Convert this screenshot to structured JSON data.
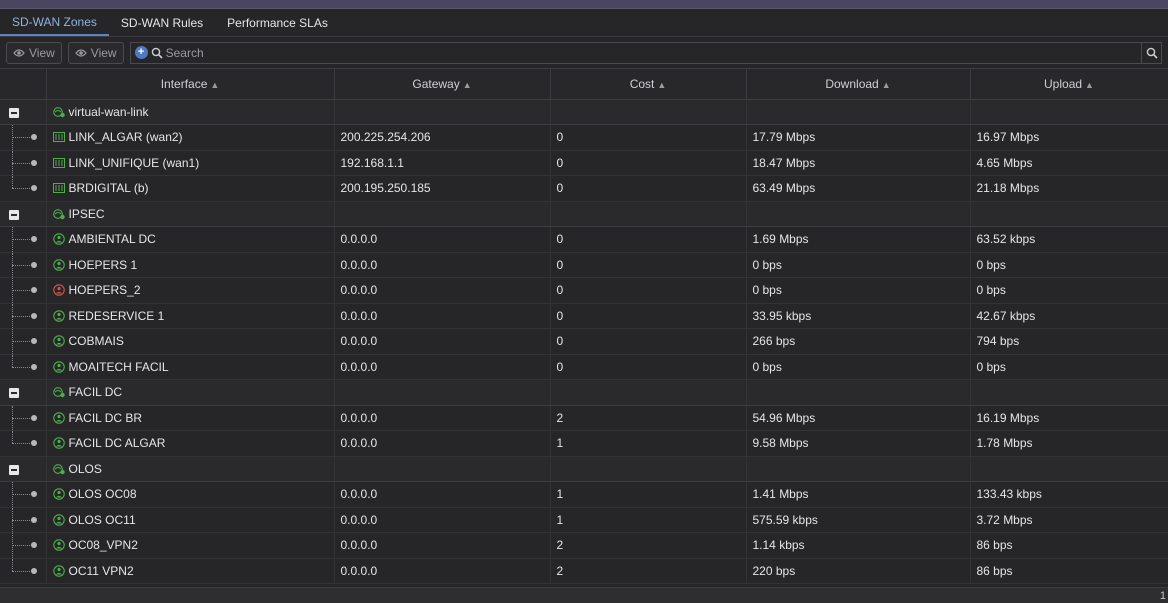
{
  "tabs": [
    "SD-WAN Zones",
    "SD-WAN Rules",
    "Performance SLAs"
  ],
  "toolbar": {
    "view1": "View",
    "view2": "View",
    "search_placeholder": "Search"
  },
  "columns": [
    "Interface",
    "Gateway",
    "Cost",
    "Download",
    "Upload"
  ],
  "groups": [
    {
      "name": "virtual-wan-link",
      "icon": "sdwan-zone-icon",
      "rows": [
        {
          "name": "LINK_ALGAR (wan2)",
          "icon": "port-icon",
          "gateway": "200.225.254.206",
          "cost": "0",
          "download": "17.79 Mbps",
          "upload": "16.97 Mbps"
        },
        {
          "name": "LINK_UNIFIQUE (wan1)",
          "icon": "port-icon",
          "gateway": "192.168.1.1",
          "cost": "0",
          "download": "18.47 Mbps",
          "upload": "4.65 Mbps"
        },
        {
          "name": "BRDIGITAL (b)",
          "icon": "port-icon",
          "gateway": "200.195.250.185",
          "cost": "0",
          "download": "63.49 Mbps",
          "upload": "21.18 Mbps"
        }
      ]
    },
    {
      "name": "IPSEC",
      "icon": "sdwan-zone-icon",
      "rows": [
        {
          "name": "AMBIENTAL DC",
          "icon": "tunnel-up-icon",
          "gateway": "0.0.0.0",
          "cost": "0",
          "download": "1.69 Mbps",
          "upload": "63.52 kbps"
        },
        {
          "name": "HOEPERS 1",
          "icon": "tunnel-up-icon",
          "gateway": "0.0.0.0",
          "cost": "0",
          "download": "0 bps",
          "upload": "0 bps"
        },
        {
          "name": "HOEPERS_2",
          "icon": "tunnel-down-icon",
          "gateway": "0.0.0.0",
          "cost": "0",
          "download": "0 bps",
          "upload": "0 bps"
        },
        {
          "name": "REDESERVICE 1",
          "icon": "tunnel-up-icon",
          "gateway": "0.0.0.0",
          "cost": "0",
          "download": "33.95 kbps",
          "upload": "42.67 kbps"
        },
        {
          "name": "COBMAIS",
          "icon": "tunnel-up-icon",
          "gateway": "0.0.0.0",
          "cost": "0",
          "download": "266 bps",
          "upload": "794 bps"
        },
        {
          "name": "MOAITECH FACIL",
          "icon": "tunnel-up-icon",
          "gateway": "0.0.0.0",
          "cost": "0",
          "download": "0 bps",
          "upload": "0 bps"
        }
      ]
    },
    {
      "name": "FACIL DC",
      "icon": "sdwan-zone-icon",
      "rows": [
        {
          "name": "FACIL DC BR",
          "icon": "tunnel-up-icon",
          "gateway": "0.0.0.0",
          "cost": "2",
          "download": "54.96 Mbps",
          "upload": "16.19 Mbps"
        },
        {
          "name": "FACIL DC ALGAR",
          "icon": "tunnel-up-icon",
          "gateway": "0.0.0.0",
          "cost": "1",
          "download": "9.58 Mbps",
          "upload": "1.78 Mbps"
        }
      ]
    },
    {
      "name": "OLOS",
      "icon": "sdwan-zone-icon",
      "rows": [
        {
          "name": "OLOS OC08",
          "icon": "tunnel-up-icon",
          "gateway": "0.0.0.0",
          "cost": "1",
          "download": "1.41 Mbps",
          "upload": "133.43 kbps"
        },
        {
          "name": "OLOS OC11",
          "icon": "tunnel-up-icon",
          "gateway": "0.0.0.0",
          "cost": "1",
          "download": "575.59 kbps",
          "upload": "3.72 Mbps"
        },
        {
          "name": "OC08_VPN2",
          "icon": "tunnel-up-icon",
          "gateway": "0.0.0.0",
          "cost": "2",
          "download": "1.14 kbps",
          "upload": "86 bps"
        },
        {
          "name": "OC11 VPN2",
          "icon": "tunnel-up-icon",
          "gateway": "0.0.0.0",
          "cost": "2",
          "download": "220 bps",
          "upload": "86 bps"
        }
      ]
    }
  ],
  "status": {
    "right_text": "1"
  },
  "colors": {
    "accent": "#5b84c4",
    "status_up": "#4cae4c",
    "status_down": "#d9534f"
  }
}
